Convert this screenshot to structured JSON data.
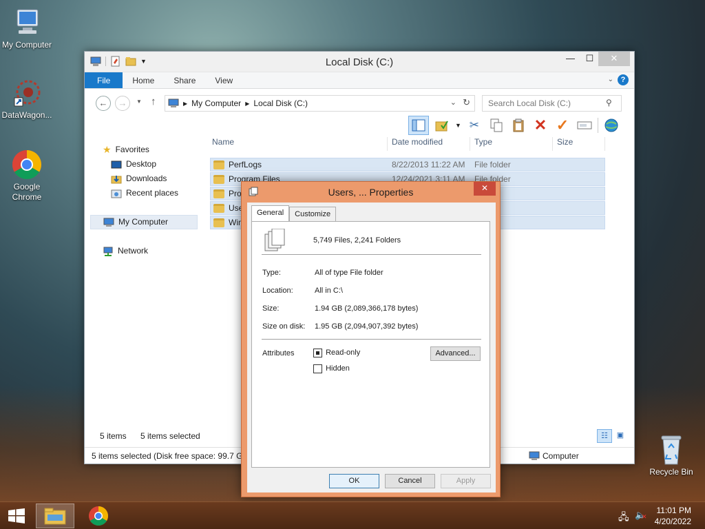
{
  "desktop": {
    "icons": [
      {
        "label": "My Computer"
      },
      {
        "label": "DataWagon..."
      },
      {
        "label": "Google Chrome"
      },
      {
        "label": "Recycle Bin"
      }
    ]
  },
  "explorer": {
    "title": "Local Disk (C:)",
    "tabs": [
      "File",
      "Home",
      "Share",
      "View"
    ],
    "breadcrumb": [
      "My Computer",
      "Local Disk (C:)"
    ],
    "search_placeholder": "Search Local Disk (C:)",
    "nav": {
      "favorites": "Favorites",
      "favorite_items": [
        "Desktop",
        "Downloads",
        "Recent places"
      ],
      "computer": "My Computer",
      "network": "Network"
    },
    "columns": [
      "Name",
      "Date modified",
      "Type",
      "Size"
    ],
    "rows": [
      {
        "name": "PerfLogs",
        "date": "8/22/2013 11:22 AM",
        "type": "File folder"
      },
      {
        "name": "Program Files",
        "date": "12/24/2021 3:11 AM",
        "type": "File folder"
      },
      {
        "name": "Prog",
        "date": "",
        "type": "lder"
      },
      {
        "name": "User",
        "date": "",
        "type": "lder"
      },
      {
        "name": "Win",
        "date": "",
        "type": "lder"
      }
    ],
    "status": {
      "items": "5 items",
      "selected": "5 items selected",
      "bottom": "5 items selected (Disk free space: 99.7 GB)",
      "location": "Computer"
    }
  },
  "dialog": {
    "title": "Users, ... Properties",
    "tabs": [
      "General",
      "Customize"
    ],
    "summary": "5,749 Files, 2,241 Folders",
    "type_label": "Type:",
    "type_value": "All of type File folder",
    "location_label": "Location:",
    "location_value": "All in C:\\",
    "size_label": "Size:",
    "size_value": "1.94 GB (2,089,366,178 bytes)",
    "disk_label": "Size on disk:",
    "disk_value": "1.95 GB (2,094,907,392 bytes)",
    "attributes_label": "Attributes",
    "readonly": "Read-only",
    "hidden": "Hidden",
    "advanced": "Advanced...",
    "ok": "OK",
    "cancel": "Cancel",
    "apply": "Apply"
  },
  "taskbar": {
    "time": "11:01 PM",
    "date": "4/20/2022"
  }
}
